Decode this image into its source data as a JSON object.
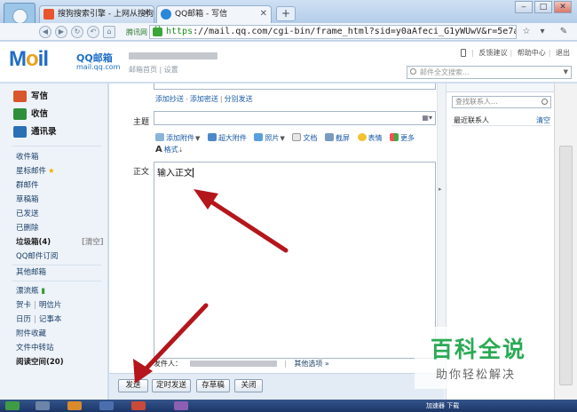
{
  "browser": {
    "tabs": [
      {
        "title": "搜狗搜索引擎 - 上网从搜狗",
        "icon_color": "#e8542e"
      },
      {
        "title": "QQ邮箱 - 写信",
        "icon_color": "#2b88d8"
      }
    ],
    "new_tab_label": "+",
    "address": {
      "secure_scheme": "https",
      "url_rest": "://mail.qq.com/cgi-bin/frame_html?sid=y0aAfeci_G1yWUwV&r=5e7a9"
    },
    "bookmark_label": "腾讯网",
    "window_buttons": [
      "‒",
      "□",
      "✕"
    ],
    "colors": {
      "chrome": "#c9dcf0",
      "accent": "#1f6ec7"
    }
  },
  "mail_header": {
    "logo_text": "Mail",
    "logo_cn": "QQ邮箱",
    "logo_domain": "mail.qq.com",
    "account_links": "邮箱首页 | 设置",
    "top_links": [
      "反馈建议",
      "帮助中心",
      "退出"
    ],
    "search_placeholder": "邮件全文搜索..."
  },
  "sidebar": {
    "primary": [
      {
        "label": "写信",
        "icon": "compose-icon",
        "color": "#d9552c"
      },
      {
        "label": "收信",
        "icon": "inbox-icon",
        "color": "#2f8f3a"
      },
      {
        "label": "通讯录",
        "icon": "contacts-icon",
        "color": "#2b6fb7"
      }
    ],
    "folders": [
      "收件箱",
      "星标邮件",
      "群邮件",
      "草稿箱",
      "已发送",
      "已删除"
    ],
    "trash": {
      "label": "垃圾箱(4)",
      "clear": "[清空]"
    },
    "qq_subscribe": "QQ邮件订阅",
    "other_mail": "其他邮箱",
    "apps": [
      {
        "label": "漂流瓶"
      },
      {
        "a": "贺卡",
        "b": "明信片"
      },
      {
        "a": "日历",
        "b": "记事本"
      },
      {
        "label": "附件收藏"
      },
      {
        "label": "文件中转站"
      },
      {
        "label": "阅读空间(20)"
      }
    ]
  },
  "compose": {
    "cc_links": [
      "添加抄送",
      "添加密送",
      "分别发送"
    ],
    "subject_label": "主题",
    "attach_tools": [
      "添加附件",
      "超大附件",
      "照片",
      "文档",
      "截屏",
      "表情",
      "更多"
    ],
    "format_label": "格式",
    "body_label": "正文",
    "body_text": "输入正文",
    "sender_label": "发件人：",
    "other_options": "其他选项",
    "buttons": [
      "发送",
      "定时发送",
      "存草稿",
      "关闭"
    ]
  },
  "contacts": {
    "search_placeholder": "查找联系人...",
    "recent_label": "最近联系人",
    "clear_label": "清空"
  },
  "watermark": {
    "title": "百科全说",
    "subtitle": "助你轻松解决"
  },
  "statusbar": {
    "right_text": "加速器   下载"
  }
}
